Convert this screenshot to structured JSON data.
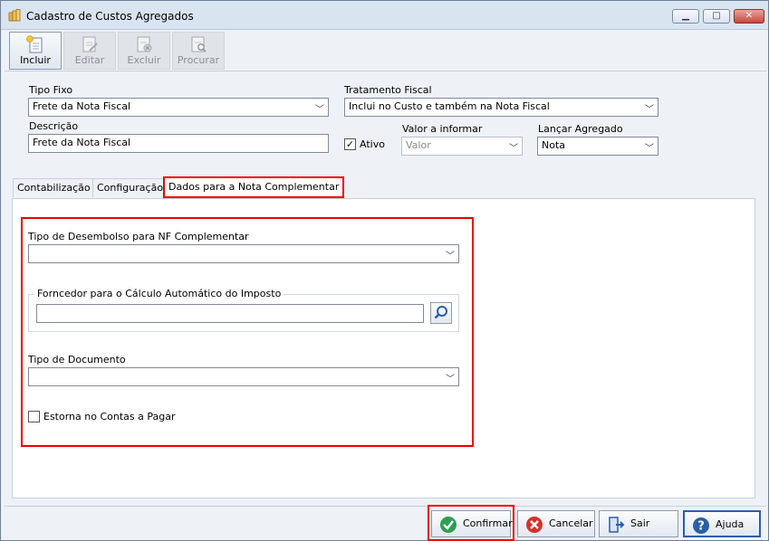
{
  "window": {
    "title": "Cadastro de Custos Agregados",
    "minimize": "▁",
    "maximize": "□",
    "close": "✕"
  },
  "toolbar": {
    "buttons": [
      {
        "label": "Incluir",
        "icon": "new-document-icon",
        "enabled": true
      },
      {
        "label": "Editar",
        "icon": "edit-document-icon",
        "enabled": false
      },
      {
        "label": "Excluir",
        "icon": "delete-document-icon",
        "enabled": false
      },
      {
        "label": "Procurar",
        "icon": "search-document-icon",
        "enabled": false
      }
    ]
  },
  "form": {
    "tipo_fixo_label": "Tipo Fixo",
    "tipo_fixo_value": "Frete da Nota Fiscal",
    "tratamento_fiscal_label": "Tratamento Fiscal",
    "tratamento_fiscal_value": "Inclui no Custo e também na Nota Fiscal",
    "descricao_label": "Descrição",
    "descricao_value": "Frete da Nota Fiscal",
    "ativo_label": "Ativo",
    "ativo_checked": true,
    "valor_label": "Valor a informar",
    "valor_value": "Valor",
    "lancar_label": "Lançar Agregado",
    "lancar_value": "Nota"
  },
  "tabs": [
    {
      "label": "Contabilização",
      "selected": false
    },
    {
      "label": "Configuração",
      "selected": false
    },
    {
      "label": "Dados para a Nota Complementar",
      "selected": true
    }
  ],
  "nota_complementar": {
    "tipo_desembolso_label": "Tipo de Desembolso para NF Complementar",
    "tipo_desembolso_value": "",
    "fornecedor_group_title": "Forncedor para o Cálculo Automático do Imposto",
    "fornecedor_value": "",
    "tipo_documento_label": "Tipo de Documento",
    "tipo_documento_value": "",
    "estorna_label": "Estorna no Contas a Pagar",
    "estorna_checked": false
  },
  "bottom_buttons": {
    "confirmar": "Confirmar",
    "cancelar": "Cancelar",
    "sair": "Sair",
    "ajuda": "Ajuda"
  },
  "colors": {
    "highlight": "#e00000",
    "confirm_icon": "#2e9e4f",
    "cancel_icon": "#d0342c",
    "exit_icon": "#2a5ea8",
    "help_icon": "#2a5ea8"
  }
}
